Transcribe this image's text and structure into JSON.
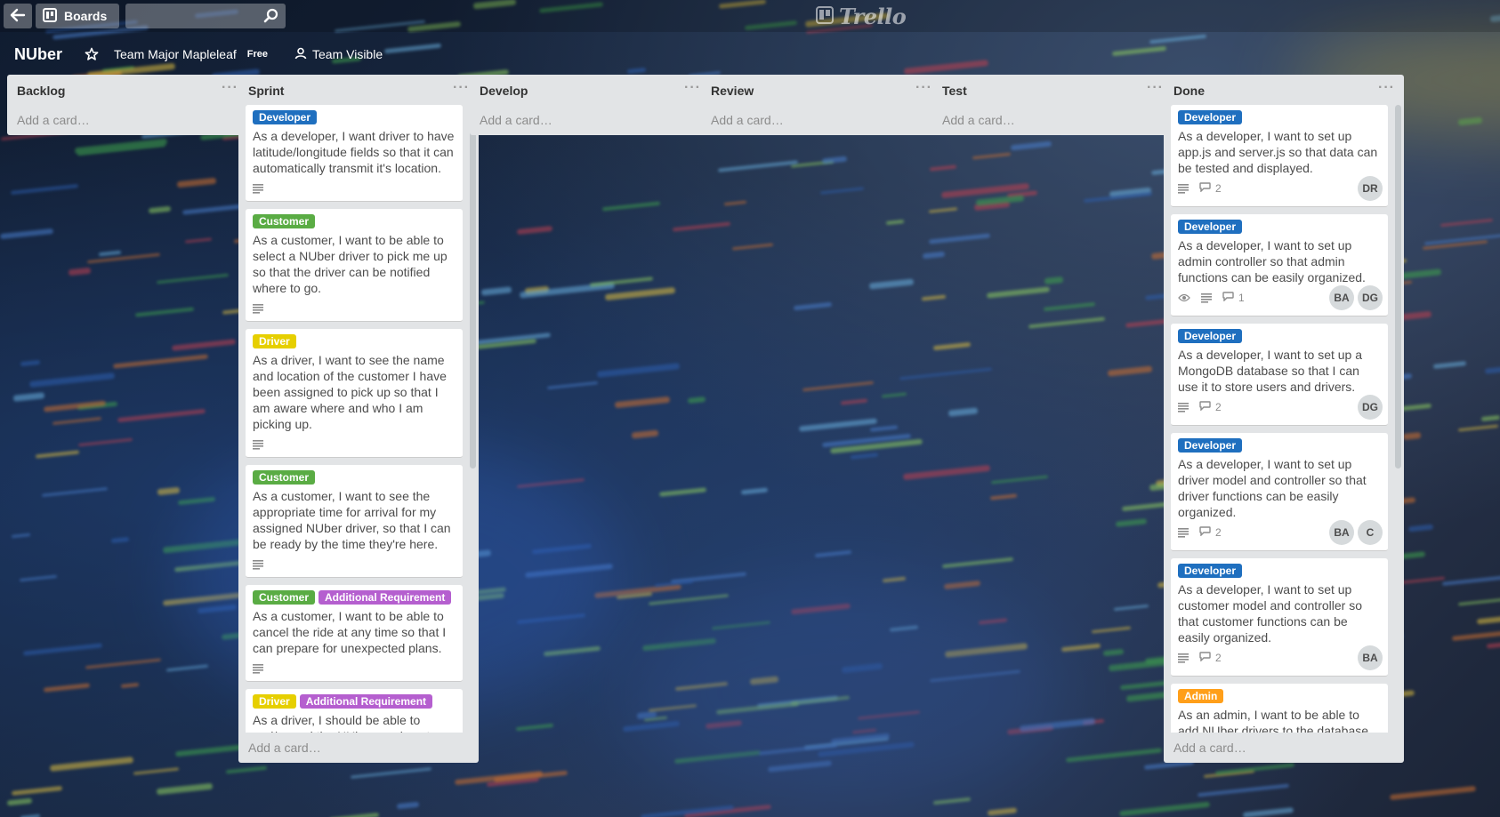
{
  "colors": {
    "Developer": "#1f6fbf",
    "Customer": "#5aac44",
    "Driver": "#e6cf00",
    "Additional Requirement": "#b55fcf",
    "Admin": "#ff9f1a"
  },
  "header": {
    "boards_label": "Boards",
    "search_value": "",
    "logo_text": "Trello"
  },
  "board": {
    "title": "NUber",
    "team": "Team Major Mapleleaf",
    "plan": "Free",
    "visibility": "Team Visible"
  },
  "lists": [
    {
      "title": "Backlog",
      "menu": "···",
      "add_card": "Add a card…",
      "cards": []
    },
    {
      "title": "Sprint",
      "menu": "···",
      "add_card": "Add a card…",
      "cards": [
        {
          "labels": [
            "Developer"
          ],
          "text": "As a developer, I want driver to have latitude/longitude fields so that it can automatically transmit it's location.",
          "description": true,
          "comments": "",
          "watch": false,
          "members": []
        },
        {
          "labels": [
            "Customer"
          ],
          "text": "As a customer, I want to be able to select a NUber driver to pick me up so that the driver can be notified where to go.",
          "description": true,
          "comments": "",
          "watch": false,
          "members": []
        },
        {
          "labels": [
            "Driver"
          ],
          "text": "As a driver, I want to see the name and location of the customer I have been assigned to pick up so that I am aware where and who I am picking up.",
          "description": true,
          "comments": "",
          "watch": false,
          "members": []
        },
        {
          "labels": [
            "Customer"
          ],
          "text": "As a customer, I want to see the appropriate time for arrival for my assigned NUber driver, so that I can be ready by the time they're here.",
          "description": true,
          "comments": "",
          "watch": false,
          "members": []
        },
        {
          "labels": [
            "Customer",
            "Additional Requirement"
          ],
          "text": "As a customer, I want to be able to cancel the ride at any time so that I can prepare for unexpected plans.",
          "description": true,
          "comments": "",
          "watch": false,
          "members": []
        },
        {
          "labels": [
            "Driver",
            "Additional Requirement"
          ],
          "text": "As a driver, I should be able to end/cancel the NUber service at any time so that I can pick up other",
          "description": false,
          "comments": "",
          "watch": false,
          "members": []
        }
      ]
    },
    {
      "title": "Develop",
      "menu": "···",
      "add_card": "Add a card…",
      "cards": []
    },
    {
      "title": "Review",
      "menu": "···",
      "add_card": "Add a card…",
      "cards": []
    },
    {
      "title": "Test",
      "menu": "···",
      "add_card": "Add a card…",
      "cards": []
    },
    {
      "title": "Done",
      "menu": "···",
      "add_card": "Add a card…",
      "cards": [
        {
          "labels": [
            "Developer"
          ],
          "text": "As a developer, I want to set up app.js and server.js so that data can be tested and displayed.",
          "description": true,
          "comments": "2",
          "watch": false,
          "members": [
            "DR"
          ]
        },
        {
          "labels": [
            "Developer"
          ],
          "text": "As a developer, I want to set up admin controller so that admin functions can be easily organized.",
          "description": true,
          "comments": "1",
          "watch": true,
          "members": [
            "BA",
            "DG"
          ]
        },
        {
          "labels": [
            "Developer"
          ],
          "text": "As a developer, I want to set up a MongoDB database so that I can use it to store users and drivers.",
          "description": true,
          "comments": "2",
          "watch": false,
          "members": [
            "DG"
          ]
        },
        {
          "labels": [
            "Developer"
          ],
          "text": "As a developer, I want to set up driver model and controller so that driver functions can be easily organized.",
          "description": true,
          "comments": "2",
          "watch": false,
          "members": [
            "BA",
            "C"
          ]
        },
        {
          "labels": [
            "Developer"
          ],
          "text": "As a developer, I want to set up customer model and controller so that customer functions can be easily organized.",
          "description": true,
          "comments": "2",
          "watch": false,
          "members": [
            "BA"
          ]
        },
        {
          "labels": [
            "Admin"
          ],
          "text": "As an admin, I want to be able to add NUber drivers to the database,",
          "description": false,
          "comments": "",
          "watch": false,
          "members": []
        }
      ]
    }
  ]
}
